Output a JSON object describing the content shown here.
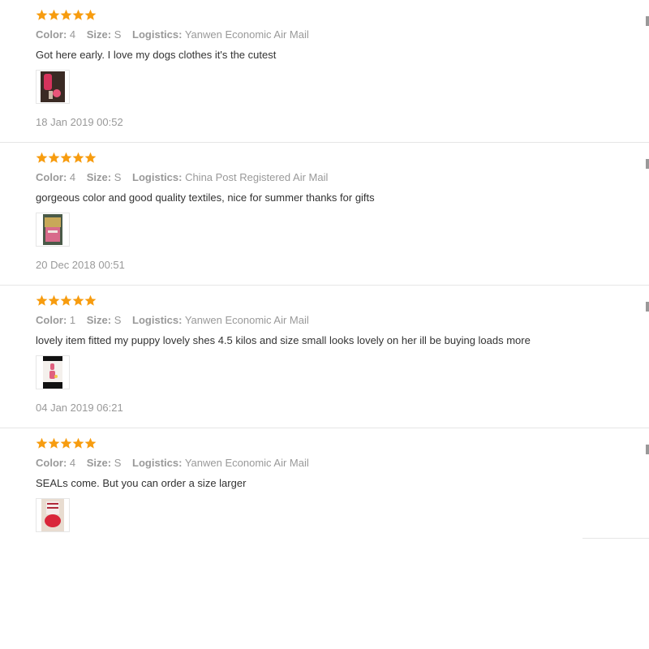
{
  "labels": {
    "color": "Color:",
    "size": "Size:",
    "logistics": "Logistics:"
  },
  "colors": {
    "star": "#f79c0f",
    "muted_text": "#999999",
    "body_text": "#333333",
    "divider": "#e6e6e6"
  },
  "reviews": [
    {
      "rating": 5,
      "color": "4",
      "size": "S",
      "logistics": "Yanwen Economic Air Mail",
      "text": "Got here early. I love my dogs clothes it's the cutest",
      "thumbnail": "review-photo",
      "date": "18 Jan 2019 00:52"
    },
    {
      "rating": 5,
      "color": "4",
      "size": "S",
      "logistics": "China Post Registered Air Mail",
      "text": "gorgeous color and good quality textiles, nice for summer thanks for gifts",
      "thumbnail": "review-photo",
      "date": "20 Dec 2018 00:51"
    },
    {
      "rating": 5,
      "color": "1",
      "size": "S",
      "logistics": "Yanwen Economic Air Mail",
      "text": "lovely item fitted my puppy lovely shes 4.5 kilos and size small looks lovely on her ill be buying loads more",
      "thumbnail": "review-photo",
      "date": "04 Jan 2019 06:21"
    },
    {
      "rating": 5,
      "color": "4",
      "size": "S",
      "logistics": "Yanwen Economic Air Mail",
      "text": "SEALs come. But you can order a size larger",
      "thumbnail": "review-photo",
      "date": ""
    }
  ]
}
